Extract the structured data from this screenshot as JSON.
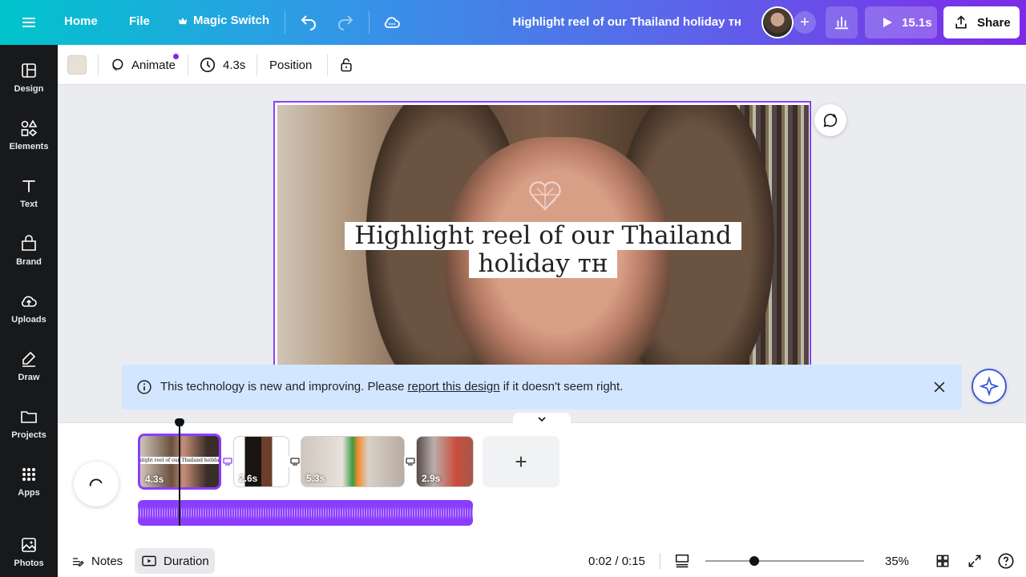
{
  "topbar": {
    "home": "Home",
    "file": "File",
    "magic_switch": "Magic Switch",
    "title": "Highlight reel of our Thailand holiday ᴛʜ",
    "play_duration": "15.1s",
    "share": "Share"
  },
  "sidebar": {
    "items": [
      {
        "label": "Design",
        "icon": "design-icon"
      },
      {
        "label": "Elements",
        "icon": "elements-icon"
      },
      {
        "label": "Text",
        "icon": "text-icon"
      },
      {
        "label": "Brand",
        "icon": "brand-icon"
      },
      {
        "label": "Uploads",
        "icon": "uploads-icon"
      },
      {
        "label": "Draw",
        "icon": "draw-icon"
      },
      {
        "label": "Projects",
        "icon": "projects-icon"
      },
      {
        "label": "Apps",
        "icon": "apps-icon"
      },
      {
        "label": "Photos",
        "icon": "photos-icon"
      }
    ]
  },
  "toolbar": {
    "animate": "Animate",
    "duration": "4.3s",
    "position": "Position",
    "swatch_color": "#e8e0d6"
  },
  "canvas": {
    "title_line1": "Highlight reel of our Thailand",
    "title_line2": "holiday ᴛʜ"
  },
  "notice": {
    "prefix": "This technology is new and improving. Please ",
    "link": "report this design",
    "suffix": " if it doesn't seem right."
  },
  "timeline": {
    "clips": [
      {
        "duration": "4.3s",
        "caption": "Highlight reel of our Thailand holiday ᴛʜ"
      },
      {
        "duration": "2.6s"
      },
      {
        "duration": "5.3s"
      },
      {
        "duration": "2.9s"
      }
    ]
  },
  "bottom": {
    "notes": "Notes",
    "duration": "Duration",
    "time": "0:02 / 0:15",
    "zoom": "35%"
  },
  "colors": {
    "accent": "#8b3dff",
    "notice_bg": "#d3e6ff"
  }
}
